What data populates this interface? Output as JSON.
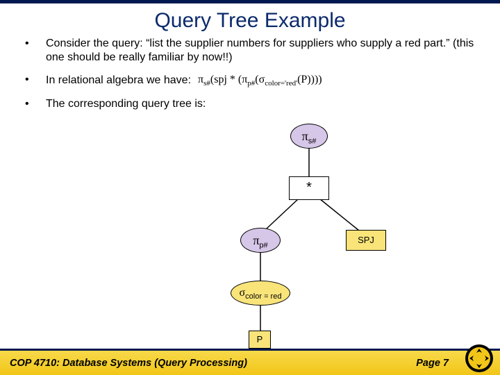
{
  "title": "Query Tree Example",
  "bullets": {
    "b1": "Consider the query: “list the supplier numbers for suppliers who supply a red part.”  (this one should be really familiar by now!!)",
    "b2": "In relational algebra we have:",
    "b3": "The corresponding query tree is:"
  },
  "algebra": {
    "pi1": "π",
    "sub1": "s#",
    "lp1": "(spj",
    "star": " * ",
    "lp2": "(",
    "pi2": "π",
    "sub2": "p#",
    "lp3": "(",
    "sigma": "σ",
    "sub3": "color='red'",
    "lp4": "(P))))"
  },
  "tree": {
    "pi_s": {
      "sym": "π",
      "sub": "s#"
    },
    "star": "*",
    "pi_p": {
      "sym": "π",
      "sub": "p#"
    },
    "spj": "SPJ",
    "sigma": {
      "sym": "σ",
      "sub": "color = red"
    },
    "p": "P"
  },
  "footer": {
    "course": "COP 4710: Database Systems (Query Processing)",
    "page": "Page 7"
  }
}
